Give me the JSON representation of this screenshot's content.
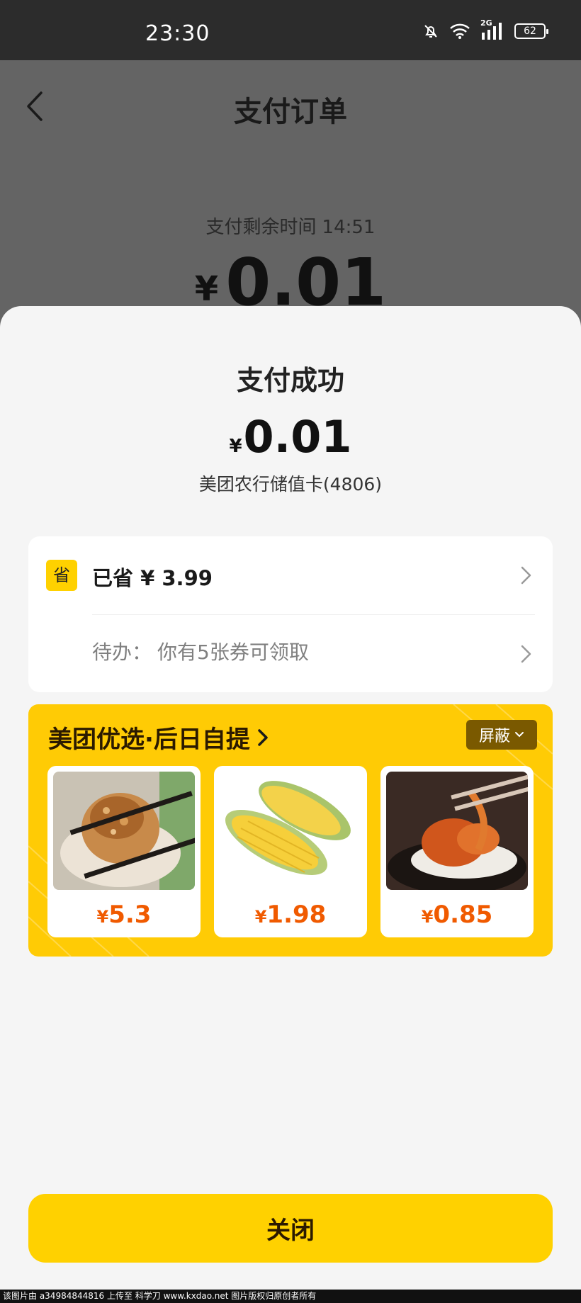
{
  "status_bar": {
    "time": "23:30",
    "network": "2G",
    "battery": "62"
  },
  "background_page": {
    "title": "支付订单",
    "timer_label": "支付剩余时间",
    "timer_value": "14:51",
    "currency": "¥",
    "amount": "0.01"
  },
  "sheet": {
    "title": "支付成功",
    "currency": "¥",
    "amount": "0.01",
    "card": "美团农行储值卡(4806)",
    "savings": {
      "badge": "省",
      "label": "已省 ¥ 3.99"
    },
    "todo": {
      "label": "待办：",
      "text": "你有5张券可领取"
    },
    "promo": {
      "title": "美团优选·后日自提",
      "block_label": "屏蔽",
      "products": [
        {
          "currency": "¥",
          "price": "5.3",
          "image": "dumpling-photo"
        },
        {
          "currency": "¥",
          "price": "1.98",
          "image": "corn-photo"
        },
        {
          "currency": "¥",
          "price": "0.85",
          "image": "braised-dish-photo"
        }
      ]
    },
    "close_label": "关闭"
  },
  "watermark": "该图片由 a34984844816 上传至 科学刀 www.kxdao.net 图片版权归原创者所有",
  "colors": {
    "accent": "#ffd100",
    "price": "#f05a00",
    "promo_bg": "#ffcb05",
    "dim": "#646464"
  }
}
